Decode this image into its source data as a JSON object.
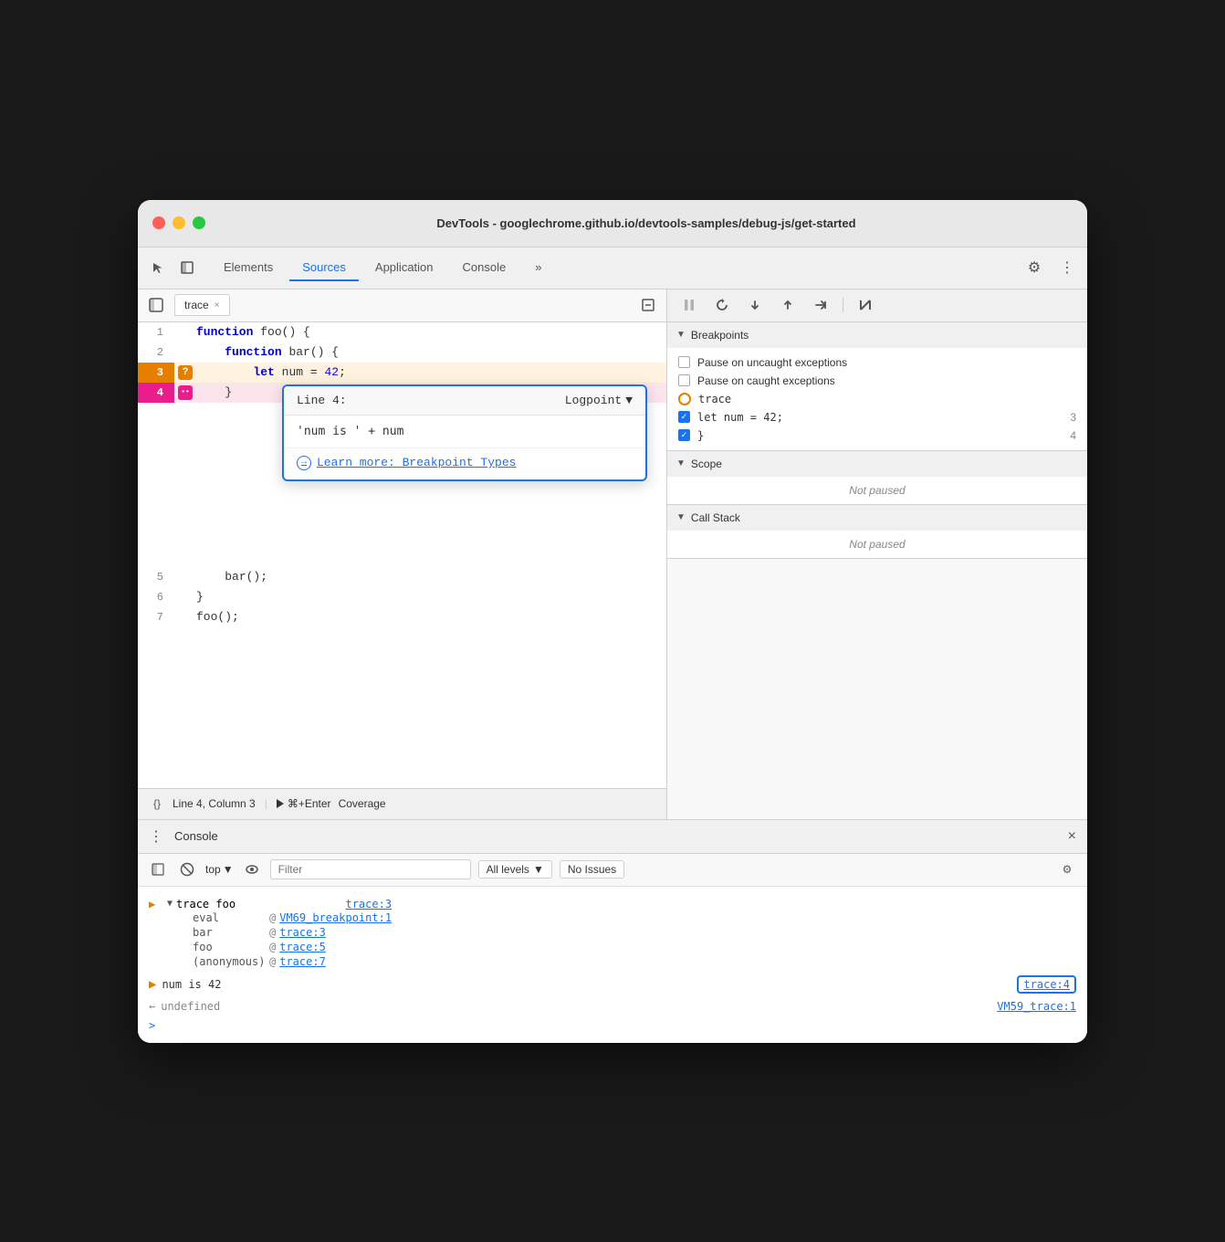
{
  "window": {
    "title": "DevTools - googlechrome.github.io/devtools-samples/debug-js/get-started",
    "traffic_lights": {
      "red": "close",
      "yellow": "minimize",
      "green": "maximize"
    }
  },
  "toolbar": {
    "tabs": [
      {
        "label": "Elements",
        "active": false
      },
      {
        "label": "Sources",
        "active": true
      },
      {
        "label": "Application",
        "active": false
      },
      {
        "label": "Console",
        "active": false
      }
    ],
    "more_label": "»",
    "settings_icon": "⚙",
    "more_icon": "⋮"
  },
  "left_panel": {
    "file_tab": {
      "name": "trace",
      "close": "×"
    },
    "code": {
      "lines": [
        {
          "num": 1,
          "content": "function foo() {",
          "badge": null
        },
        {
          "num": 2,
          "content": "    function bar() {",
          "badge": null
        },
        {
          "num": 3,
          "content": "        let num = 42;",
          "badge": "question"
        },
        {
          "num": 4,
          "content": "    }",
          "badge": "dot"
        }
      ],
      "lines_after": [
        {
          "num": 5,
          "content": "    bar();"
        },
        {
          "num": 6,
          "content": "}"
        },
        {
          "num": 7,
          "content": "foo();"
        }
      ]
    },
    "logpoint": {
      "title": "Line 4:",
      "type": "Logpoint",
      "input_value": "'num is ' + num",
      "link_text": "Learn more: Breakpoint Types"
    },
    "status_bar": {
      "icon": "{}",
      "position": "Line 4, Column 3",
      "run_label": "⌘+Enter",
      "coverage": "Coverage"
    }
  },
  "right_panel": {
    "debug_toolbar": {
      "pause_icon": "⏸",
      "reload_icon": "↺",
      "step_over": "↓",
      "step_up": "↑",
      "step_forward": "→→",
      "deactivate": "⊘"
    },
    "breakpoints": {
      "title": "Breakpoints",
      "pause_uncaught": "Pause on uncaught exceptions",
      "pause_caught": "Pause on caught exceptions",
      "entries": [
        {
          "icon": "orange_circle",
          "name": "trace",
          "code": null,
          "line": null
        },
        {
          "icon": "checkbox",
          "name": null,
          "code": "let num = 42;",
          "line": "3"
        },
        {
          "icon": "checkbox",
          "name": null,
          "code": "}",
          "line": "4"
        }
      ]
    },
    "scope": {
      "title": "Scope",
      "status": "Not paused"
    },
    "call_stack": {
      "title": "Call Stack",
      "status": "Not paused"
    }
  },
  "console": {
    "title": "Console",
    "close_icon": "×",
    "toolbar": {
      "clear_icon": "🚫",
      "filter_placeholder": "Filter",
      "levels_label": "All levels",
      "issues_label": "No Issues",
      "top_label": "top"
    },
    "entries": [
      {
        "type": "trace_group",
        "icon": "▶",
        "header": "trace foo",
        "source": "trace:3",
        "rows": [
          {
            "label": "eval",
            "at": "@",
            "link": "VM69_breakpoint:1"
          },
          {
            "label": "bar",
            "at": "@",
            "link": "trace:3"
          },
          {
            "label": "foo",
            "at": "@",
            "link": "trace:5"
          },
          {
            "label": "(anonymous)",
            "at": "@",
            "link": "trace:7"
          }
        ]
      },
      {
        "type": "output",
        "icon_type": "orange_arrow",
        "text": "num is 42",
        "source": "trace:4",
        "source_outlined": true
      },
      {
        "type": "output",
        "icon_type": "gray_arrow",
        "text": "undefined",
        "source": "VM59_trace:1",
        "source_outlined": false
      }
    ],
    "prompt": ">"
  }
}
